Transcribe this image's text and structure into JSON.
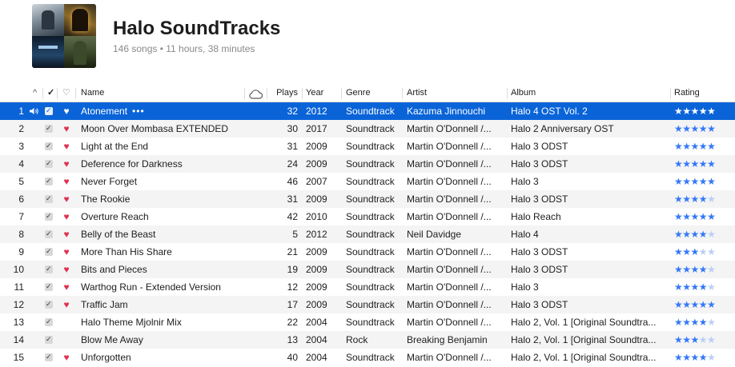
{
  "playlist": {
    "title": "Halo SoundTracks",
    "subtitle": "146 songs • 11 hours, 38 minutes"
  },
  "columns": {
    "sort_arrow": "^",
    "check": "✓",
    "heart": "♡",
    "name": "Name",
    "cloud_icon": "cloud-icon",
    "plays": "Plays",
    "year": "Year",
    "genre": "Genre",
    "artist": "Artist",
    "album": "Album",
    "rating": "Rating"
  },
  "colors": {
    "selection": "#0a64d8",
    "heart": "#e0304f",
    "stars": "#3478f6"
  },
  "tracks": [
    {
      "num": "1",
      "name": "Atonement",
      "more": "•••",
      "plays": "32",
      "year": "2012",
      "genre": "Soundtrack",
      "artist": "Kazuma Jinnouchi",
      "album": "Halo 4 OST Vol. 2",
      "loved": true,
      "rating": 5,
      "selected": true,
      "playing": true
    },
    {
      "num": "2",
      "name": "Moon Over Mombasa EXTENDED",
      "plays": "30",
      "year": "2017",
      "genre": "Soundtrack",
      "artist": "Martin O'Donnell /...",
      "album": "Halo 2 Anniversary OST",
      "loved": true,
      "rating": 5
    },
    {
      "num": "3",
      "name": "Light at the End",
      "plays": "31",
      "year": "2009",
      "genre": "Soundtrack",
      "artist": "Martin O'Donnell /...",
      "album": "Halo 3 ODST",
      "loved": true,
      "rating": 5
    },
    {
      "num": "4",
      "name": "Deference for Darkness",
      "plays": "24",
      "year": "2009",
      "genre": "Soundtrack",
      "artist": "Martin O'Donnell /...",
      "album": "Halo 3 ODST",
      "loved": true,
      "rating": 5
    },
    {
      "num": "5",
      "name": "Never Forget",
      "plays": "46",
      "year": "2007",
      "genre": "Soundtrack",
      "artist": "Martin O'Donnell /...",
      "album": "Halo 3",
      "loved": true,
      "rating": 5
    },
    {
      "num": "6",
      "name": "The Rookie",
      "plays": "31",
      "year": "2009",
      "genre": "Soundtrack",
      "artist": "Martin O'Donnell /...",
      "album": "Halo 3 ODST",
      "loved": true,
      "rating": 4
    },
    {
      "num": "7",
      "name": "Overture Reach",
      "plays": "42",
      "year": "2010",
      "genre": "Soundtrack",
      "artist": "Martin O'Donnell /...",
      "album": "Halo Reach",
      "loved": true,
      "rating": 5
    },
    {
      "num": "8",
      "name": "Belly of the Beast",
      "plays": "5",
      "year": "2012",
      "genre": "Soundtrack",
      "artist": "Neil Davidge",
      "album": "Halo 4",
      "loved": true,
      "rating": 4
    },
    {
      "num": "9",
      "name": "More Than His Share",
      "plays": "21",
      "year": "2009",
      "genre": "Soundtrack",
      "artist": "Martin O'Donnell /...",
      "album": "Halo 3 ODST",
      "loved": true,
      "rating": 3
    },
    {
      "num": "10",
      "name": "Bits and Pieces",
      "plays": "19",
      "year": "2009",
      "genre": "Soundtrack",
      "artist": "Martin O'Donnell /...",
      "album": "Halo 3 ODST",
      "loved": true,
      "rating": 4
    },
    {
      "num": "11",
      "name": "Warthog Run - Extended Version",
      "plays": "12",
      "year": "2009",
      "genre": "Soundtrack",
      "artist": "Martin O'Donnell /...",
      "album": "Halo 3",
      "loved": true,
      "rating": 4
    },
    {
      "num": "12",
      "name": "Traffic Jam",
      "plays": "17",
      "year": "2009",
      "genre": "Soundtrack",
      "artist": "Martin O'Donnell /...",
      "album": "Halo 3 ODST",
      "loved": true,
      "rating": 5
    },
    {
      "num": "13",
      "name": "Halo Theme Mjolnir Mix",
      "plays": "22",
      "year": "2004",
      "genre": "Soundtrack",
      "artist": "Martin O'Donnell /...",
      "album": "Halo 2, Vol. 1 [Original Soundtra...",
      "loved": false,
      "rating": 4
    },
    {
      "num": "14",
      "name": "Blow Me Away",
      "plays": "13",
      "year": "2004",
      "genre": "Rock",
      "artist": "Breaking Benjamin",
      "album": "Halo 2, Vol. 1 [Original Soundtra...",
      "loved": false,
      "rating": 3
    },
    {
      "num": "15",
      "name": "Unforgotten",
      "plays": "40",
      "year": "2004",
      "genre": "Soundtrack",
      "artist": "Martin O'Donnell /...",
      "album": "Halo 2, Vol. 1 [Original Soundtra...",
      "loved": true,
      "rating": 4
    }
  ]
}
